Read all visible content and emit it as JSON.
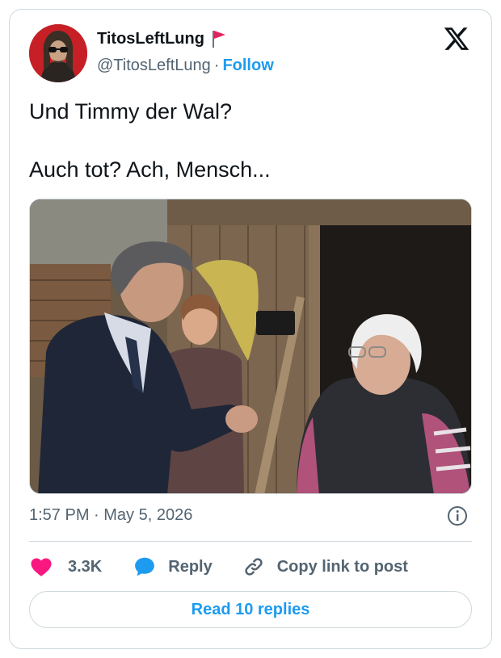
{
  "author": {
    "display_name": "TitosLeftLung",
    "handle": "@TitosLeftLung",
    "separator": "·",
    "follow_label": "Follow"
  },
  "tweet": {
    "lines": [
      "Und Timmy der Wal?",
      "Auch tot? Ach, Mensch..."
    ],
    "timestamp": "1:57 PM · May 5, 2026"
  },
  "actions": {
    "likes_count": "3.3K",
    "reply_label": "Reply",
    "copy_link_label": "Copy link to post"
  },
  "read_replies_label": "Read 10 replies",
  "icons": {
    "avatar": "avatar-icon",
    "flag": "red-flag-icon",
    "logo": "x-logo-icon",
    "info": "info-icon",
    "heart": "heart-icon",
    "reply": "speech-bubble-icon",
    "link": "link-icon"
  },
  "colors": {
    "accent": "#1d9bf0",
    "heart": "#f91880",
    "flag": "#e0245e",
    "secondary_text": "#536471",
    "border": "#cfd9de"
  }
}
